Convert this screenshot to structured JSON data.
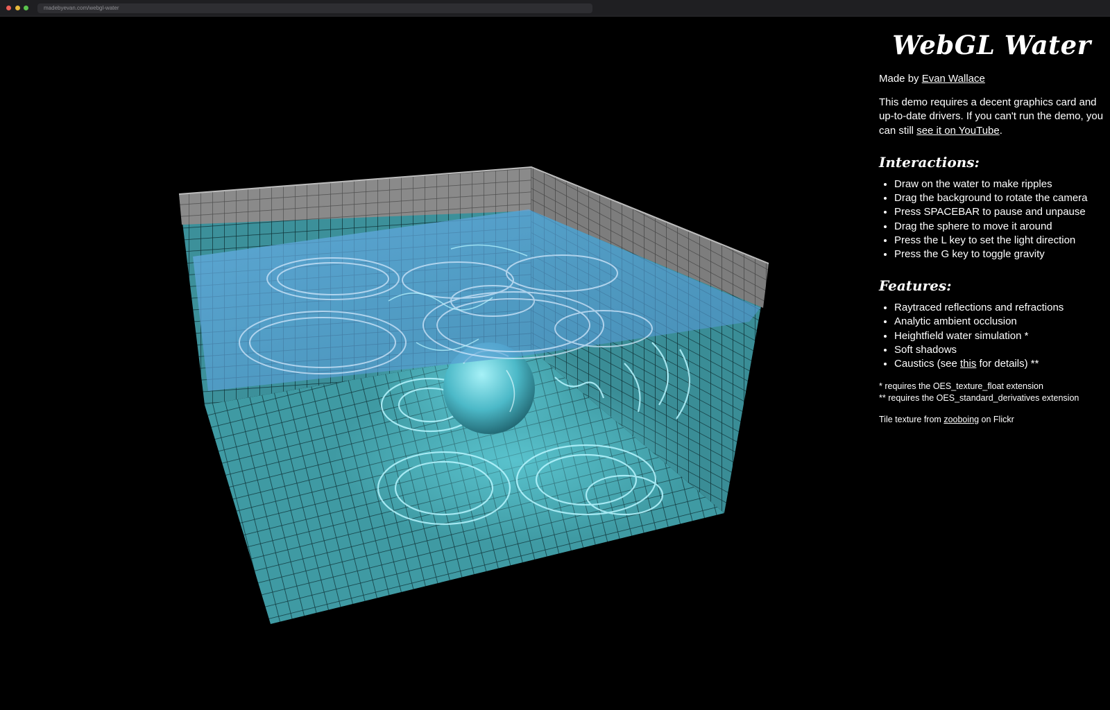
{
  "browser": {
    "url": "madebyevan.com/webgl-water"
  },
  "page": {
    "title": "WebGL Water",
    "credit": {
      "prefix": "Made by ",
      "author_link": "Evan Wallace"
    },
    "requirement": {
      "text": "This demo requires a decent graphics card and up-to-date drivers. If you can't run the demo, you can still ",
      "youtube_link": "see it on YouTube",
      "suffix": "."
    },
    "interactions": {
      "heading": "Interactions:",
      "items": [
        "Draw on the water to make ripples",
        "Drag the background to rotate the camera",
        "Press SPACEBAR to pause and unpause",
        "Drag the sphere to move it around",
        "Press the L key to set the light direction",
        "Press the G key to toggle gravity"
      ]
    },
    "features": {
      "heading": "Features:",
      "items": [
        "Raytraced reflections and refractions",
        "Analytic ambient occlusion",
        "Heightfield water simulation *",
        "Soft shadows"
      ],
      "caustics": {
        "prefix": "Caustics (see ",
        "link": "this",
        "suffix": " for details) **"
      }
    },
    "footnotes": [
      "* requires the OES_texture_float extension",
      "** requires the OES_standard_derivatives extension"
    ],
    "tile_credit": {
      "prefix": "Tile texture from ",
      "link": "zooboing",
      "suffix": " on Flickr"
    }
  },
  "colors": {
    "background": "#000000",
    "tile": "#3f9aa3",
    "tile_line": "#123a40",
    "water": "#4a9fd6",
    "caustic": "#b8f6ff",
    "rim_tile": "#8e8e8e",
    "sphere": "#5cc8d6"
  }
}
